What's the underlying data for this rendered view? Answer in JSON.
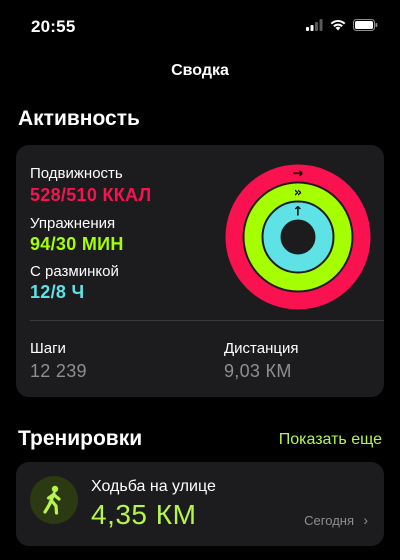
{
  "status": {
    "time": "20:55"
  },
  "nav": {
    "title": "Сводка"
  },
  "activity": {
    "section_title": "Активность",
    "move": {
      "label": "Подвижность",
      "value": "528/510 ККАЛ",
      "fraction": 1.035,
      "color": "#fa114f"
    },
    "exercise": {
      "label": "Упражнения",
      "value": "94/30 МИН",
      "fraction": 3.13,
      "color": "#a6ff00"
    },
    "stand": {
      "label": "С разминкой",
      "value": "12/8 Ч",
      "fraction": 1.5,
      "color": "#5ee2e6"
    },
    "steps": {
      "label": "Шаги",
      "value": "12 239"
    },
    "distance": {
      "label": "Дистанция",
      "value": "9,03 КМ"
    }
  },
  "workouts": {
    "section_title": "Тренировки",
    "show_more": "Показать еще",
    "items": [
      {
        "icon": "walking-figure-icon",
        "name": "Ходьба на улице",
        "value": "4,35 КМ",
        "date": "Сегодня"
      }
    ]
  }
}
